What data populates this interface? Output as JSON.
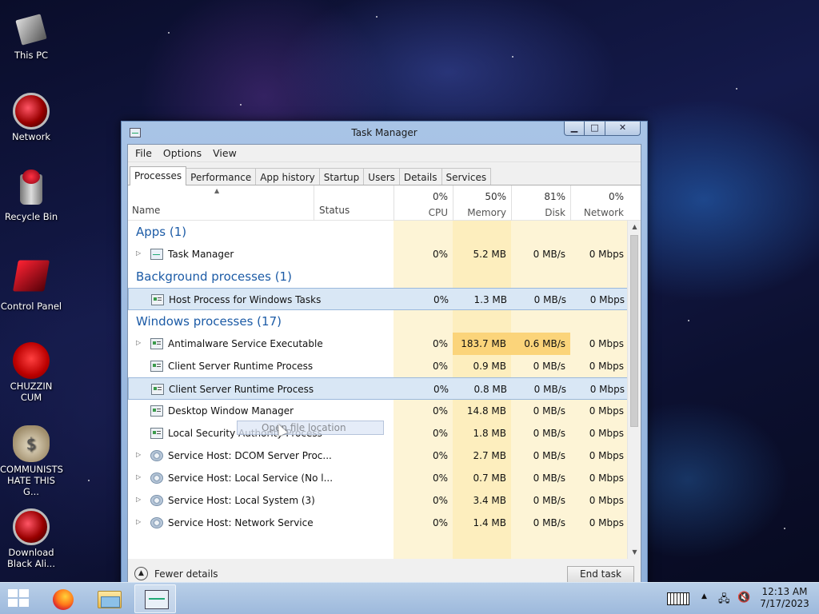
{
  "desktop": {
    "icons": [
      {
        "label": "This PC"
      },
      {
        "label": "Network"
      },
      {
        "label": "Recycle Bin"
      },
      {
        "label": "Control Panel"
      },
      {
        "label": "CHUZZIN CUM"
      },
      {
        "label": "COMMUNISTS HATE THIS G..."
      },
      {
        "label": "Download Black Ali..."
      }
    ]
  },
  "window": {
    "title": "Task Manager",
    "minimize_glyph": "▁",
    "maximize_glyph": "□",
    "close_glyph": "✕"
  },
  "menu": [
    "File",
    "Options",
    "View"
  ],
  "tabs": [
    "Processes",
    "Performance",
    "App history",
    "Startup",
    "Users",
    "Details",
    "Services"
  ],
  "active_tab": "Processes",
  "columns": {
    "name": "Name",
    "status": "Status",
    "cpu": {
      "pct": "0%",
      "label": "CPU"
    },
    "memory": {
      "pct": "50%",
      "label": "Memory"
    },
    "disk": {
      "pct": "81%",
      "label": "Disk"
    },
    "network": {
      "pct": "0%",
      "label": "Network"
    }
  },
  "rows": [
    {
      "group": "Apps (1)"
    },
    {
      "name": "Task Manager",
      "expand": true,
      "icon": "task-manager-icon",
      "cpu": "0%",
      "mem": "5.2 MB",
      "disk": "0 MB/s",
      "net": "0 Mbps"
    },
    {
      "group": "Background processes (1)"
    },
    {
      "name": "Host Process for Windows Tasks",
      "expand": false,
      "icon": "process-icon",
      "cpu": "0%",
      "mem": "1.3 MB",
      "disk": "0 MB/s",
      "net": "0 Mbps",
      "selected": true
    },
    {
      "group": "Windows processes (17)"
    },
    {
      "name": "Antimalware Service Executable",
      "expand": true,
      "icon": "process-icon",
      "cpu": "0%",
      "mem": "183.7 MB",
      "disk": "0.6 MB/s",
      "net": "0 Mbps",
      "hot": true
    },
    {
      "name": "Client Server Runtime Process",
      "expand": false,
      "icon": "process-icon",
      "cpu": "0%",
      "mem": "0.9 MB",
      "disk": "0 MB/s",
      "net": "0 Mbps"
    },
    {
      "name": "Client Server Runtime Process",
      "expand": false,
      "icon": "process-icon",
      "cpu": "0%",
      "mem": "0.8 MB",
      "disk": "0 MB/s",
      "net": "0 Mbps",
      "selected": true
    },
    {
      "name": "Desktop Window Manager",
      "expand": false,
      "icon": "process-icon",
      "cpu": "0%",
      "mem": "14.8 MB",
      "disk": "0 MB/s",
      "net": "0 Mbps"
    },
    {
      "name": "Local Security Authority Process",
      "expand": false,
      "icon": "process-icon",
      "cpu": "0%",
      "mem": "1.8 MB",
      "disk": "0 MB/s",
      "net": "0 Mbps"
    },
    {
      "name": "Service Host: DCOM Server Proc...",
      "expand": true,
      "icon": "gear-icon",
      "cpu": "0%",
      "mem": "2.7 MB",
      "disk": "0 MB/s",
      "net": "0 Mbps"
    },
    {
      "name": "Service Host: Local Service (No l...",
      "expand": true,
      "icon": "gear-icon",
      "cpu": "0%",
      "mem": "0.7 MB",
      "disk": "0 MB/s",
      "net": "0 Mbps"
    },
    {
      "name": "Service Host: Local System (3)",
      "expand": true,
      "icon": "gear-icon",
      "cpu": "0%",
      "mem": "3.4 MB",
      "disk": "0 MB/s",
      "net": "0 Mbps"
    },
    {
      "name": "Service Host: Network Service",
      "expand": true,
      "icon": "gear-icon",
      "cpu": "0%",
      "mem": "1.4 MB",
      "disk": "0 MB/s",
      "net": "0 Mbps"
    }
  ],
  "context_ghost": "Open file location",
  "footer": {
    "fewer_details": "Fewer details",
    "end_task": "End task"
  },
  "taskbar": {
    "apps": [
      "firefox-icon",
      "file-explorer-icon",
      "task-manager-icon"
    ],
    "time": "12:13 AM",
    "date": "7/17/2023"
  },
  "colors": {
    "cpu_col": "#fdf4d6",
    "mem_col": "#fdeebe",
    "hot_cell": "#fbd47a",
    "group_text": "#1c5ba6"
  }
}
